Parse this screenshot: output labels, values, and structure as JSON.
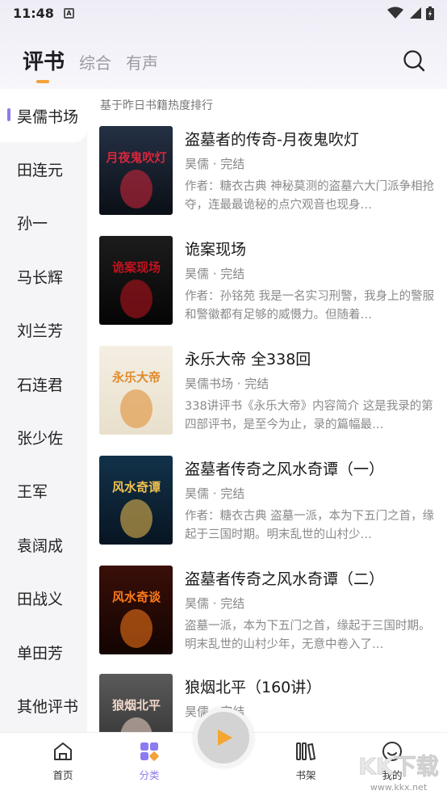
{
  "status_bar": {
    "time": "11:48",
    "notif_letter": "A"
  },
  "header": {
    "tabs": [
      "评书",
      "综合",
      "有声"
    ]
  },
  "sidebar": {
    "items": [
      "昊儒书场",
      "田连元",
      "孙一",
      "马长辉",
      "刘兰芳",
      "石连君",
      "张少佐",
      "王军",
      "袁阔成",
      "田战义",
      "单田芳",
      "其他评书"
    ]
  },
  "list": {
    "hint": "基于昨日书籍热度排行",
    "books": [
      {
        "title": "盗墓者的传奇-月夜鬼吹灯",
        "meta": "昊儒 · 完结",
        "desc": "作者：糖衣古典 神秘莫测的盗墓六大门派争相抢夺，连最最诡秘的点穴观音也现身…",
        "cover_text": "月夜鬼吹灯",
        "cover_colors": [
          "#243044",
          "#0b0f16"
        ],
        "accent": "#d7263d"
      },
      {
        "title": "诡案现场",
        "meta": "昊儒 · 完结",
        "desc": "作者：孙铭苑 我是一名实习刑警，我身上的警服和警徽都有足够的威慑力。但随着…",
        "cover_text": "诡案现场",
        "cover_colors": [
          "#1c1c1c",
          "#050505"
        ],
        "accent": "#c1121f"
      },
      {
        "title": "永乐大帝 全338回",
        "meta": "昊儒书场 · 完结",
        "desc": "338讲评书《永乐大帝》内容简介 这是我录的第四部评书，是至今为止，录的篇幅最…",
        "cover_text": "永乐大帝",
        "cover_colors": [
          "#f4efe3",
          "#e8e0cc"
        ],
        "accent": "#e0892a"
      },
      {
        "title": "盗墓者传奇之风水奇谭（一）",
        "meta": "昊儒 · 完结",
        "desc": "作者：糖衣古典 盗墓一派，本为下五门之首，缘起于三国时期。明末乱世的山村少…",
        "cover_text": "风水奇谭",
        "cover_colors": [
          "#12324a",
          "#081522"
        ],
        "accent": "#f2c14e"
      },
      {
        "title": "盗墓者传奇之风水奇谭（二）",
        "meta": "昊儒 · 完结",
        "desc": "盗墓一派，本为下五门之首，缘起于三国时期。明末乱世的山村少年，无意中卷入了…",
        "cover_text": "风水奇谈",
        "cover_colors": [
          "#3a0f08",
          "#120402"
        ],
        "accent": "#ff7a1a"
      },
      {
        "title": "狼烟北平（160讲）",
        "meta": "昊儒 · 完结",
        "desc": "",
        "cover_text": "狼烟北平",
        "cover_colors": [
          "#5a5a5a",
          "#2e2e2e"
        ],
        "accent": "#f1d7c9"
      }
    ]
  },
  "bottom_nav": {
    "home": "首页",
    "category": "分类",
    "shelf": "书架",
    "mine": "我的"
  },
  "watermark": {
    "text": "KK下载",
    "url": "www.kkx.net"
  },
  "colors": {
    "accent_purple": "#8a7cf0",
    "tab_underline": "#f2a23a"
  }
}
